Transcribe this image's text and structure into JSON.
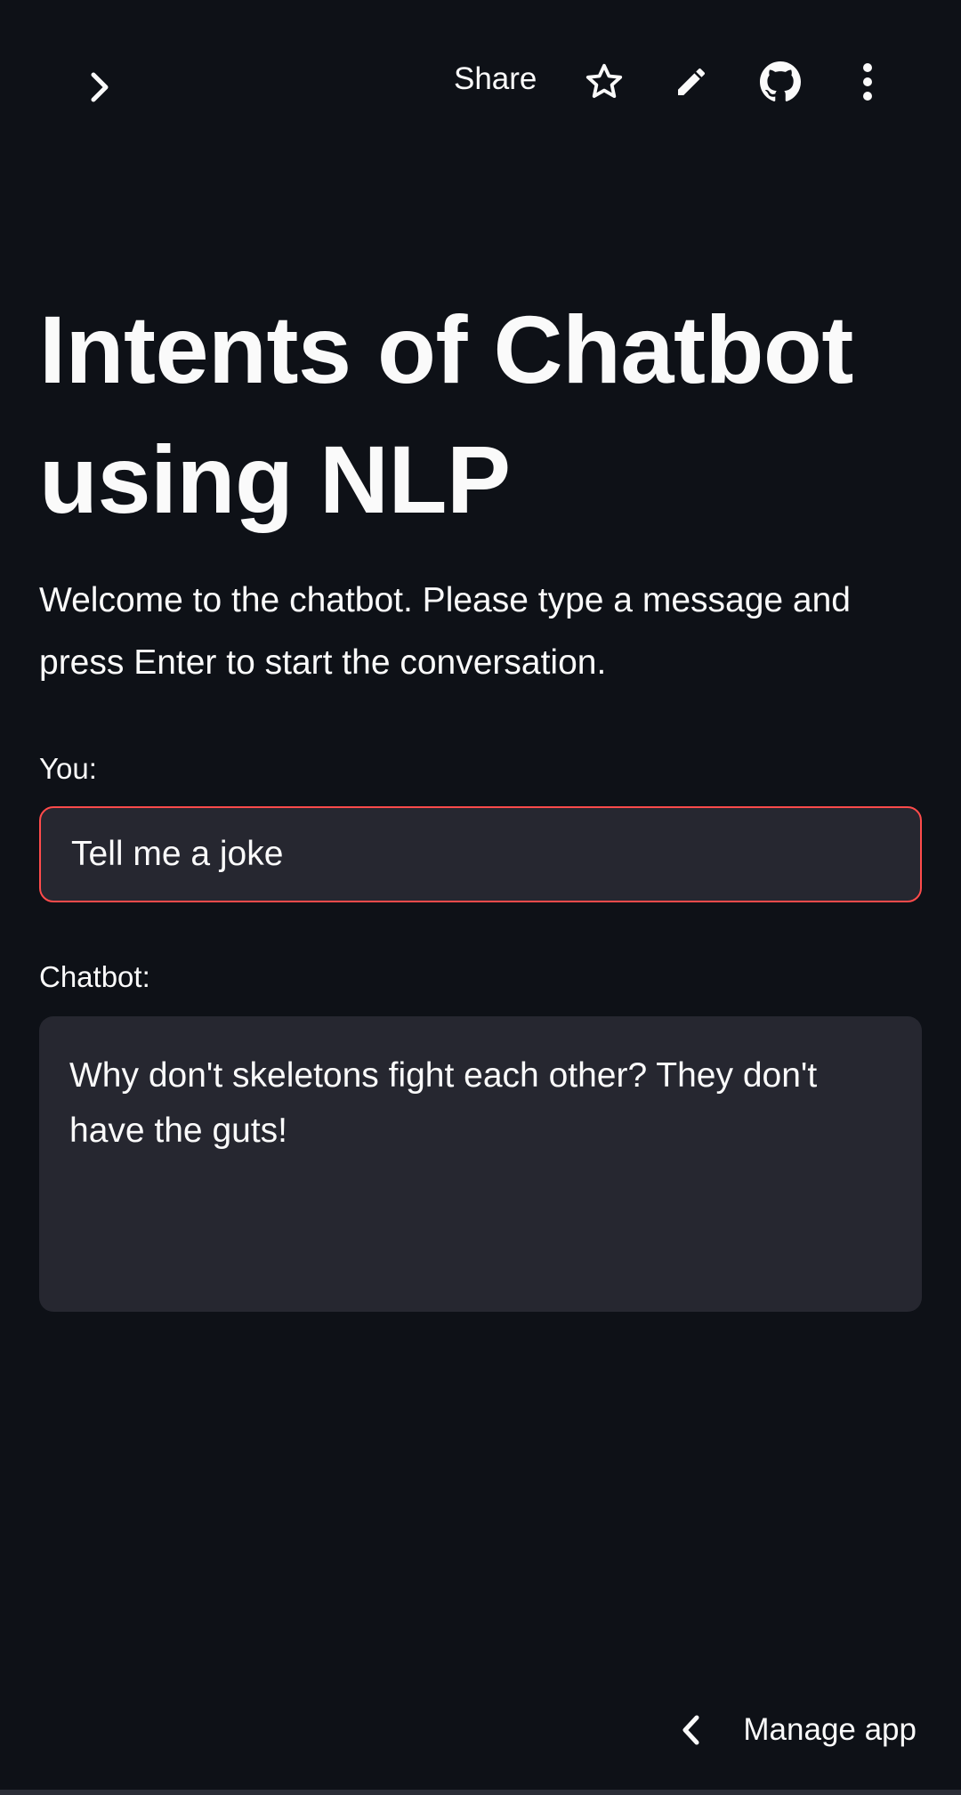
{
  "header": {
    "share_label": "Share",
    "icons": [
      "chevron-right-icon",
      "star-icon",
      "pencil-icon",
      "github-icon",
      "more-vertical-icon"
    ]
  },
  "main": {
    "title": "Intents of Chatbot using NLP",
    "intro": "Welcome to the chatbot. Please type a message and press Enter to start the conversation.",
    "you_label": "You:",
    "you_input_value": "Tell me a joke",
    "chatbot_label": "Chatbot:",
    "chatbot_response": "Why don't skeletons fight each other? They don't have the guts!"
  },
  "footer": {
    "manage_app_label": "Manage app"
  },
  "colors": {
    "background": "#0e1117",
    "text": "#fafafa",
    "input_bg": "#262730",
    "focus_border": "#ff4b4b"
  }
}
